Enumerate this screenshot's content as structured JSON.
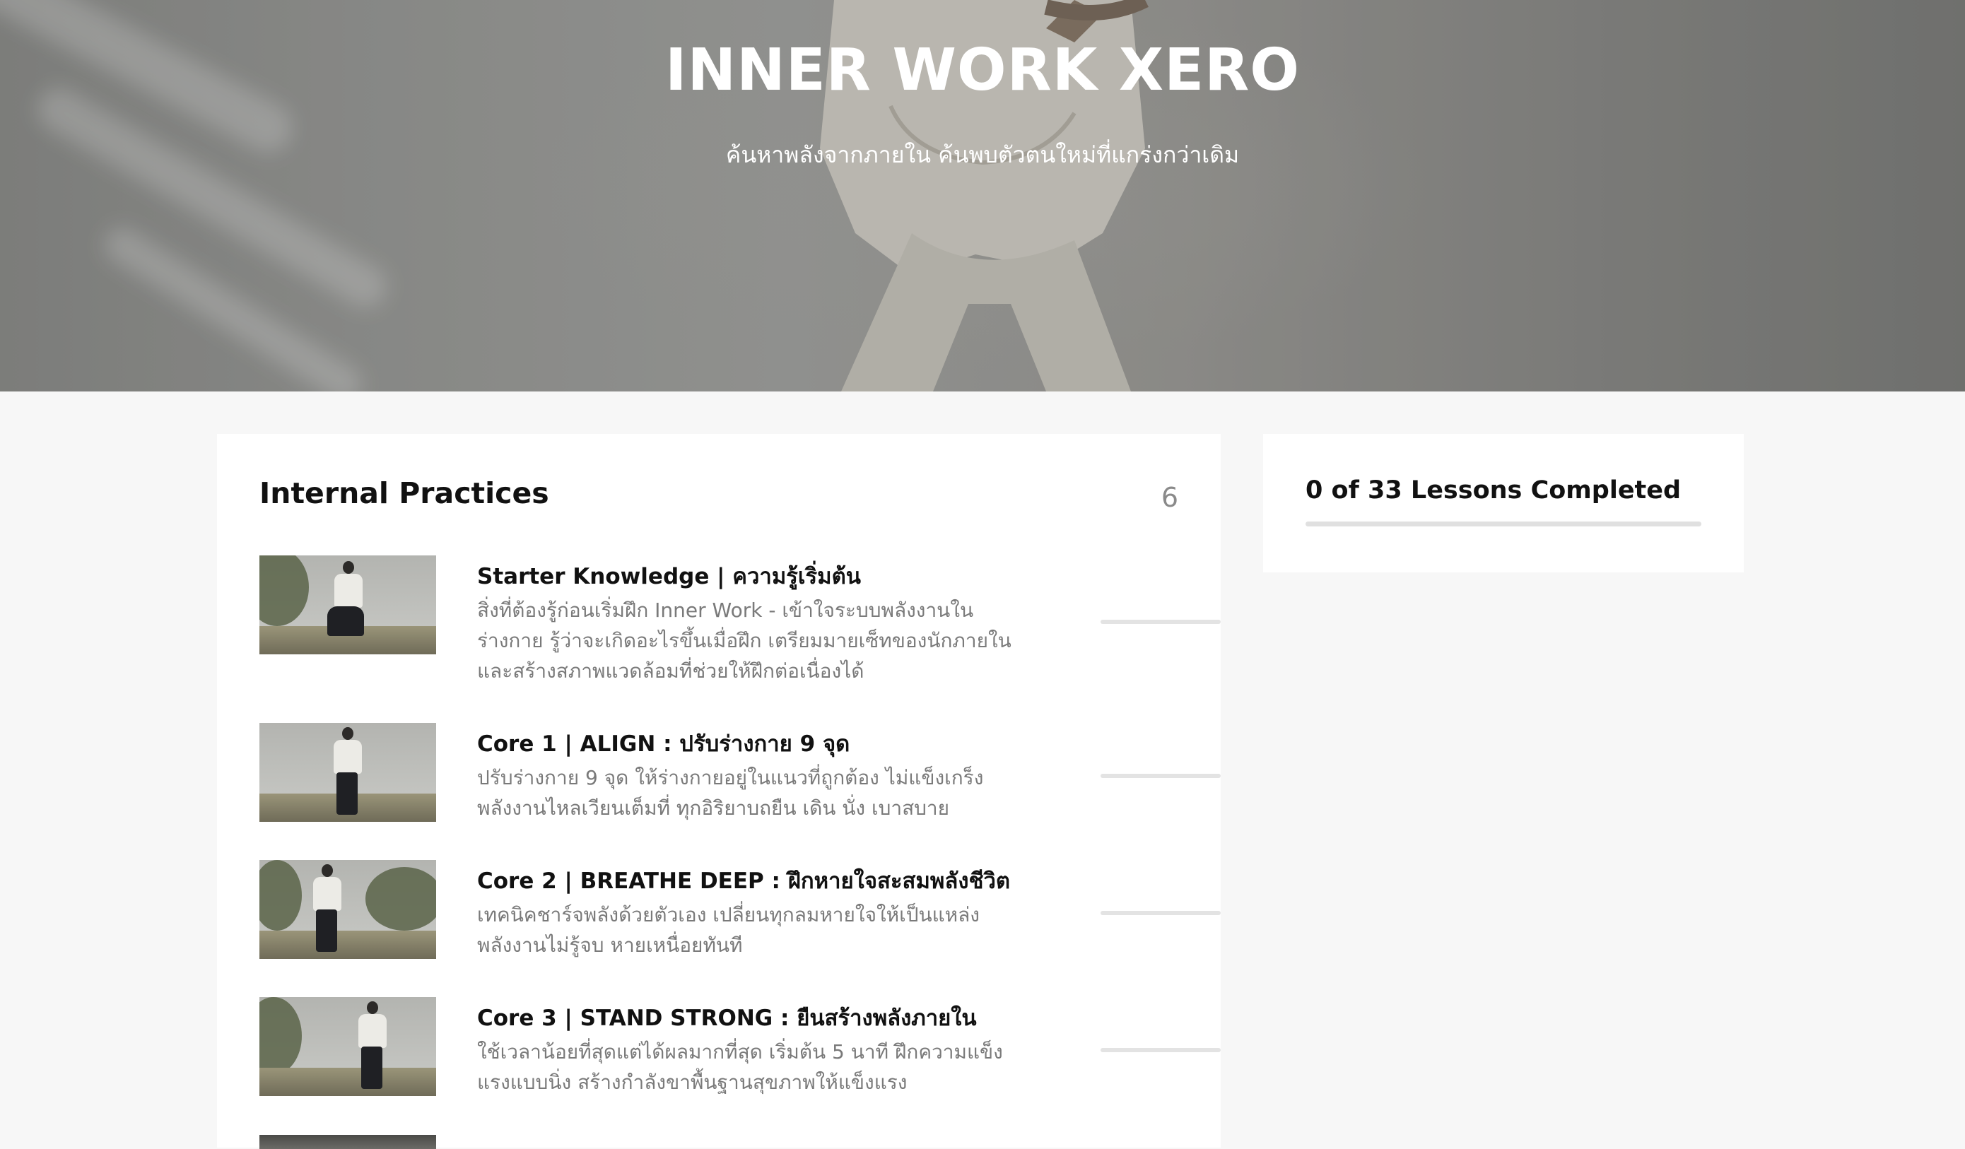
{
  "hero": {
    "title": "INNER WORK XERO",
    "subtitle": "ค้นหาพลังจากภายใน ค้นพบตัวตนใหม่ที่แกร่งกว่าเดิม"
  },
  "section": {
    "title": "Internal Practices",
    "count": "6"
  },
  "lessons": [
    {
      "title": "Starter Knowledge | ความรู้เริ่มต้น",
      "description": "สิ่งที่ต้องรู้ก่อนเริ่มฝึก Inner Work - เข้าใจระบบพลังงานในร่างกาย รู้ว่าจะเกิดอะไรขึ้นเมื่อฝึก เตรียมมายเซ็ทของนักภายใน และสร้างสภาพแวดล้อมที่ช่วยให้ฝึกต่อเนื่องได้",
      "progress": 0
    },
    {
      "title": "Core 1 | ALIGN : ปรับร่างกาย 9 จุด",
      "description": "ปรับร่างกาย 9 จุด ให้ร่างกายอยู่ในแนวที่ถูกต้อง ไม่แข็งเกร็ง พลังงานไหลเวียนเต็มที่ ทุกอิริยาบถยืน เดิน นั่ง เบาสบาย",
      "progress": 0
    },
    {
      "title": "Core 2 | BREATHE DEEP : ฝึกหายใจสะสมพลังชีวิต",
      "description": "เทคนิคชาร์จพลังด้วยตัวเอง เปลี่ยนทุกลมหายใจให้เป็นแหล่งพลังงานไม่รู้จบ หายเหนื่อยทันที",
      "progress": 0
    },
    {
      "title": "Core 3 | STAND STRONG : ยืนสร้างพลังภายใน",
      "description": "ใช้เวลาน้อยที่สุดแต่ได้ผลมากที่สุด เริ่มต้น 5 นาที ฝึกความแข็งแรงแบบนิ่ง สร้างกำลังขาพื้นฐานสุขภาพให้แข็งแรง",
      "progress": 0
    }
  ],
  "sidebar": {
    "completed_text": "0 of 33 Lessons Completed",
    "completed_fraction": 0
  },
  "colors": {
    "page_bg": "#f7f7f7",
    "card_bg": "#ffffff",
    "track": "#e3e3e3",
    "muted_text": "#7a7a7a"
  }
}
